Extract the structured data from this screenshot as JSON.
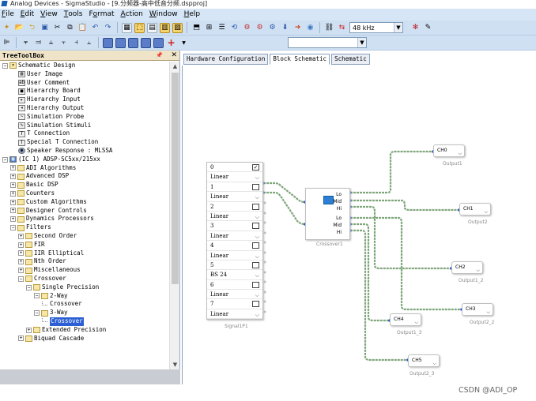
{
  "window": {
    "title": "Analog Devices - SigmaStudio - [9.分频器-高中低音分频.dspproj]"
  },
  "menu": [
    "File",
    "Edit",
    "View",
    "Tools",
    "Format",
    "Action",
    "Window",
    "Help"
  ],
  "menu_mnemonics": [
    "F",
    "E",
    "V",
    "T",
    "o",
    "A",
    "W",
    "H"
  ],
  "toolbar": {
    "sample_rate": "48 kHz"
  },
  "panel": {
    "title": "TreeToolBox",
    "pin": "📌",
    "close": "✕"
  },
  "tree": [
    {
      "label": "Schematic Design",
      "indent": 0,
      "icon": "folder-open-icon"
    },
    {
      "label": "User Image",
      "indent": 2,
      "icon": "image-icon"
    },
    {
      "label": "User Comment",
      "indent": 2,
      "icon": "comment-icon"
    },
    {
      "label": "Hierarchy Board",
      "indent": 2,
      "icon": "hierarchy-board-icon"
    },
    {
      "label": "Hierarchy Input",
      "indent": 2,
      "icon": "hierarchy-input-icon"
    },
    {
      "label": "Hierarchy Output",
      "indent": 2,
      "icon": "hierarchy-output-icon"
    },
    {
      "label": "Simulation Probe",
      "indent": 2,
      "icon": "probe-icon"
    },
    {
      "label": "Simulation Stimuli",
      "indent": 2,
      "icon": "stimuli-icon"
    },
    {
      "label": "T Connection",
      "indent": 2,
      "icon": "t-connection-icon"
    },
    {
      "label": "Special T Connection",
      "indent": 2,
      "icon": "special-t-icon"
    },
    {
      "label": "Speaker Response : MLSSA",
      "indent": 2,
      "icon": "speaker-icon"
    },
    {
      "label": "(IC 1) ADSP-SC5xx/215xx",
      "indent": 0,
      "icon": "chip-icon"
    },
    {
      "label": "ADI Algorithms",
      "indent": 1,
      "icon": "folder-icon"
    },
    {
      "label": "Advanced DSP",
      "indent": 1,
      "icon": "folder-icon"
    },
    {
      "label": "Basic DSP",
      "indent": 1,
      "icon": "folder-icon"
    },
    {
      "label": "Counters",
      "indent": 1,
      "icon": "folder-icon"
    },
    {
      "label": "Custom Algorithms",
      "indent": 1,
      "icon": "folder-icon"
    },
    {
      "label": "Designer Controls",
      "indent": 1,
      "icon": "folder-icon"
    },
    {
      "label": "Dynamics Processors",
      "indent": 1,
      "icon": "folder-icon"
    },
    {
      "label": "Filters",
      "indent": 1,
      "icon": "folder-icon"
    },
    {
      "label": "Second Order",
      "indent": 2,
      "icon": "folder-icon"
    },
    {
      "label": "FIR",
      "indent": 2,
      "icon": "folder-icon"
    },
    {
      "label": "IIR Elliptical",
      "indent": 2,
      "icon": "folder-icon"
    },
    {
      "label": "Nth Order",
      "indent": 2,
      "icon": "folder-icon"
    },
    {
      "label": "Miscellaneous",
      "indent": 2,
      "icon": "folder-icon"
    },
    {
      "label": "Crossover",
      "indent": 2,
      "icon": "folder-icon"
    },
    {
      "label": "Single Precision",
      "indent": 3,
      "icon": "folder-icon"
    },
    {
      "label": "2-Way",
      "indent": 4,
      "icon": "folder-icon"
    },
    {
      "label": "Crossover",
      "indent": 5,
      "icon": "leaf-icon"
    },
    {
      "label": "3-Way",
      "indent": 4,
      "icon": "folder-icon"
    },
    {
      "label": "Crossover",
      "indent": 5,
      "icon": "leaf-icon",
      "selected": true
    },
    {
      "label": "Extended Precision",
      "indent": 3,
      "icon": "folder-icon"
    },
    {
      "label": "Biquad Cascade",
      "indent": 2,
      "icon": "folder-icon"
    }
  ],
  "tabs": [
    {
      "label": "Hardware Configuration"
    },
    {
      "label": "Block Schematic",
      "active": true
    },
    {
      "label": "Schematic"
    }
  ],
  "signal_block": {
    "caption": "Signal1P1",
    "rows": [
      {
        "type": "index",
        "value": "0",
        "checked": true
      },
      {
        "type": "select",
        "value": "Linear"
      },
      {
        "type": "index",
        "value": "1",
        "checked": false
      },
      {
        "type": "select",
        "value": "Linear"
      },
      {
        "type": "index",
        "value": "2",
        "checked": false
      },
      {
        "type": "select",
        "value": "Linear"
      },
      {
        "type": "index",
        "value": "3",
        "checked": false
      },
      {
        "type": "select",
        "value": "Linear"
      },
      {
        "type": "index",
        "value": "4",
        "checked": false
      },
      {
        "type": "select",
        "value": "Linear"
      },
      {
        "type": "index",
        "value": "5",
        "checked": false
      },
      {
        "type": "select",
        "value": "BS 24"
      },
      {
        "type": "index",
        "value": "6",
        "checked": false
      },
      {
        "type": "select",
        "value": "Linear"
      },
      {
        "type": "index",
        "value": "7",
        "checked": false
      },
      {
        "type": "select",
        "value": "Linear"
      }
    ]
  },
  "crossover_block": {
    "caption": "Crossover1",
    "ports": [
      "Lo",
      "Mid",
      "Hi",
      "Lo",
      "Mid",
      "Hi"
    ]
  },
  "outputs": [
    {
      "label": "CH0",
      "caption": "Output1"
    },
    {
      "label": "CH1",
      "caption": "Output2"
    },
    {
      "label": "CH2",
      "caption": "Output1_2"
    },
    {
      "label": "CH3",
      "caption": "Output2_2"
    },
    {
      "label": "CH4",
      "caption": "Output1_3"
    },
    {
      "label": "CH5",
      "caption": "Output2_3"
    }
  ],
  "watermark": "CSDN @ADI_OP"
}
